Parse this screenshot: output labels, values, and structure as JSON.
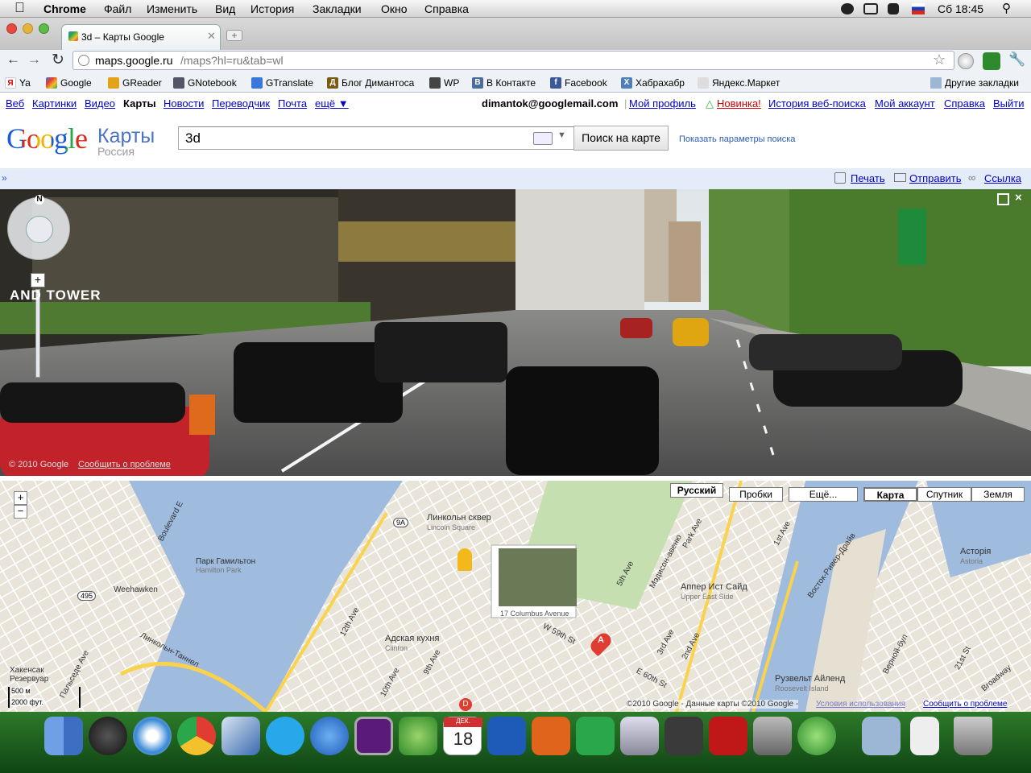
{
  "menubar": {
    "app": "Chrome",
    "items": [
      "Файл",
      "Изменить",
      "Вид",
      "История",
      "Закладки",
      "Окно",
      "Справка"
    ],
    "clock": "Сб 18:45"
  },
  "tab": {
    "title": "3d – Карты Google"
  },
  "address": {
    "host": "maps.google.ru",
    "path": "/maps?hl=ru&tab=wl"
  },
  "bookmarks": {
    "items": [
      "Ya",
      "Google",
      "GReader",
      "GNotebook",
      "GTranslate",
      "Блог Димантоса",
      "WP",
      "В Контакте",
      "Facebook",
      "Хабрахабр",
      "Яндекс.Маркет"
    ],
    "other": "Другие закладки"
  },
  "gbar": {
    "links": [
      "Веб",
      "Картинки",
      "Видео",
      "Карты",
      "Новости",
      "Переводчик",
      "Почта",
      "ещё ▼"
    ],
    "email": "dimantok@googlemail.com",
    "profile": "Мой профиль",
    "new": "Новинка!",
    "history": "История веб-поиска",
    "account": "Мой аккаунт",
    "help": "Справка",
    "logout": "Выйти"
  },
  "logo": {
    "google": "Google",
    "maps": "Карты",
    "country": "Россия"
  },
  "search": {
    "query": "3d",
    "button": "Поиск на карте",
    "options": "Показать параметры поиска"
  },
  "actions": {
    "print": "Печать",
    "send": "Отправить",
    "link": "Ссылка"
  },
  "streetview": {
    "copyright": "© 2010 Google",
    "report": "Сообщить о проблеме",
    "compass": "N",
    "sign": "AND TOWER"
  },
  "map": {
    "lang": "Русский",
    "traffic": "Пробки",
    "more": "Ещё...",
    "types": [
      "Карта",
      "Спутник",
      "Земля"
    ],
    "popup_caption": "17 Columbus Avenue",
    "labels": [
      "Линкольн сквер",
      "Lincoln Square",
      "Парк",
      "Гамильтон",
      "Hamilton Park",
      "Weehawken",
      "Адская кухня",
      "Clinton",
      "Аппер Ист Сайд",
      "Upper East Side",
      "Асторія",
      "Astoria",
      "Рузвельт Айленд",
      "Roosevelt Island",
      "Хакенсак Резервуар",
      "Пальседе Ave",
      "Линкольн-Таннел",
      "Восток-Ривер-Драйв",
      "5th Ave",
      "Мэдисон-авеню",
      "Park Ave",
      "12th Ave",
      "10th Ave",
      "9th Ave",
      "2nd Ave",
      "3rd Ave",
      "1st Ave",
      "W 59th St",
      "E 60th St",
      "Верной-бул",
      "21st St",
      "Broadway",
      "9A",
      "495",
      "Boulevard E"
    ],
    "scale_m": "500 м",
    "scale_ft": "2000 фут.",
    "data": "©2010 Google - Данные карты ©2010 Google -",
    "terms": "Условия использования",
    "report": "Сообщить о проблеме",
    "marker_a": "A",
    "marker_d": "D"
  },
  "dock": {
    "calendar_month": "ДЕК.",
    "calendar_day": "18"
  }
}
